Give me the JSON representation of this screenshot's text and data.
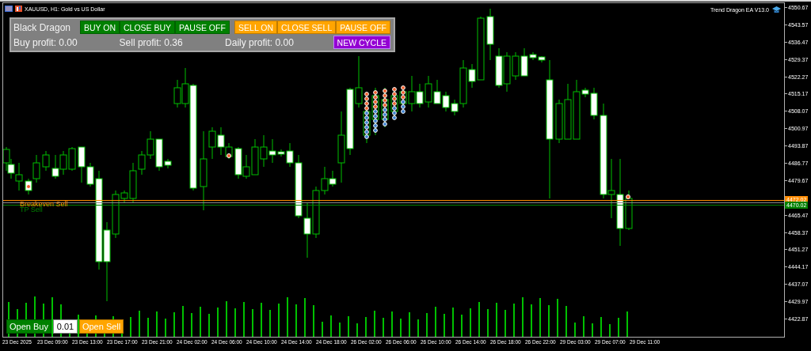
{
  "window": {
    "title": "XAUUSD, H1:  Gold vs US Dollar"
  },
  "expert_label": "Trend Dragon EA V13.0",
  "panel": {
    "name": "Black Dragon",
    "buttons": [
      {
        "label": "BUY ON",
        "color": "#008000"
      },
      {
        "label": "CLOSE BUY",
        "color": "#008000"
      },
      {
        "label": "PAUSE OFF",
        "color": "#008000"
      },
      {
        "label": "SELL ON",
        "color": "#ffa500"
      },
      {
        "label": "CLOSE SELL",
        "color": "#ffa500"
      },
      {
        "label": "PAUSE OFF",
        "color": "#ffa500"
      }
    ],
    "profits": [
      "Buy profit: 0.00",
      "Sell profit: 0.36",
      "Daily profit: 0.00"
    ],
    "cycle_button": {
      "label": "NEW CYCLE",
      "color": "#9400d3"
    }
  },
  "lines": [
    {
      "label": "Breakeven Sell",
      "color": "#ff8c00",
      "price": "4472.02"
    },
    {
      "label": "TP Sell",
      "color": "#008000",
      "price": "4470.02"
    }
  ],
  "price_axis_upper": [
    "4550.67",
    "4543.57",
    "4536.47",
    "4529.37",
    "4522.27",
    "4515.17",
    "4508.07",
    "4500.97",
    "4493.87",
    "4486.77",
    "4479.67"
  ],
  "price_axis_lower": [
    "4465.47",
    "4458.37",
    "4451.27",
    "4444.17",
    "4437.07",
    "4429.97",
    "4422.87"
  ],
  "time_axis": [
    "23 Dec 2025",
    "23 Dec 09:00",
    "23 Dec 13:00",
    "23 Dec 17:00",
    "23 Dec 21:00",
    "24 Dec 02:00",
    "24 Dec 06:00",
    "24 Dec 10:00",
    "24 Dec 14:00",
    "24 Dec 18:00",
    "26 Dec 02:00",
    "26 Dec 06:00",
    "26 Dec 10:00",
    "26 Dec 14:00",
    "26 Dec 18:00",
    "26 Dec 22:00",
    "29 Dec 03:00",
    "29 Dec 07:00",
    "29 Dec 11:00"
  ],
  "order_panel": {
    "buy_label": "Open Buy",
    "lot": "0.01",
    "sell_label": "Open Sell"
  }
}
